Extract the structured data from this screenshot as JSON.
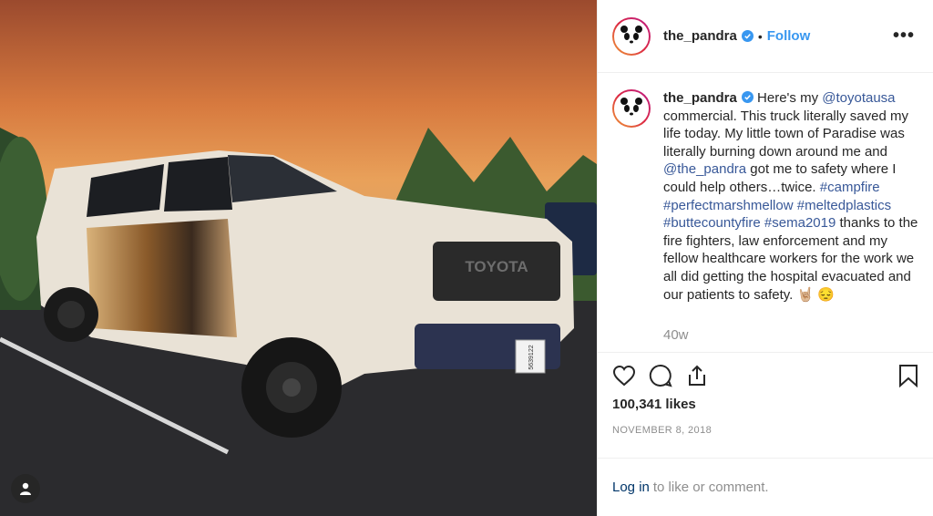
{
  "post": {
    "username": "the_pandra",
    "follow_label": "Follow",
    "dot": "•",
    "more_label": "•••",
    "caption": {
      "username": "the_pandra",
      "t1": " Here's my ",
      "m1": "@toyotausa",
      "t2": " commercial. This truck literally saved my life today. My little town of Paradise was literally burning down around me and ",
      "m2": "@the_pandra",
      "t3": " got me to safety where I could help others…twice. ",
      "h1": "#campfire",
      "s1": " ",
      "h2": "#perfectmarshmellow",
      "s2": " ",
      "h3": "#meltedplastics",
      "s3": " ",
      "h4": "#buttecountyfire",
      "s4": " ",
      "h5": "#sema2019",
      "t4": " thanks to the fire fighters, law enforcement and my fellow healthcare workers for the work we all did getting the hospital evacuated and our patients to safety. 🤘🏼 😔"
    },
    "time_ago": "40w",
    "likes": "100,341 likes",
    "date": "NOVEMBER 8, 2018",
    "login_link": "Log in",
    "login_rest": "to like or comment.",
    "plate": "5639122",
    "grille_text": "TOYOTA"
  },
  "colors": {
    "accent": "#3897f0",
    "link": "#003569",
    "muted": "#8e8e8e"
  },
  "icons": [
    "verified-icon",
    "heart-icon",
    "comment-icon",
    "share-icon",
    "bookmark-icon",
    "user-icon"
  ]
}
